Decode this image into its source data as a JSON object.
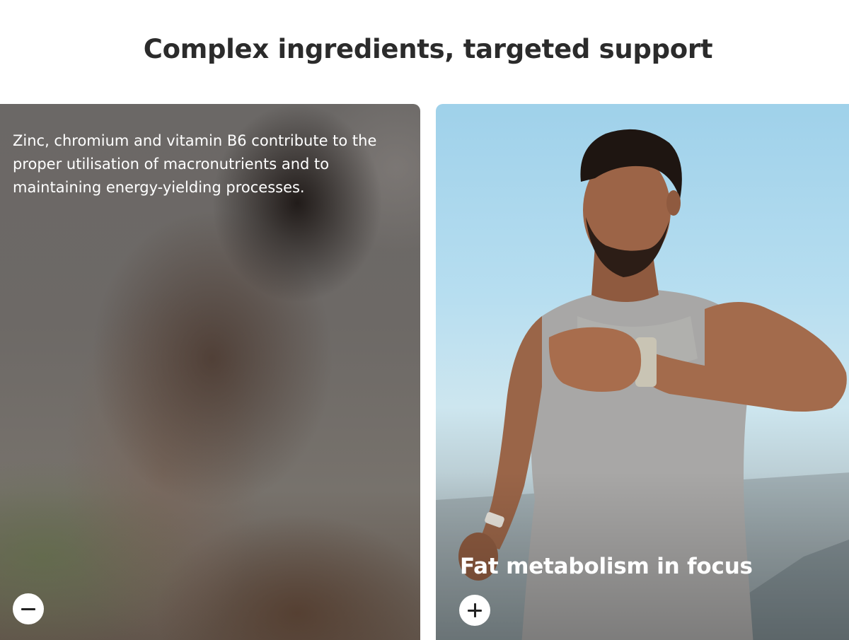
{
  "section": {
    "title": "Complex ingredients, targeted support"
  },
  "cards": [
    {
      "state": "expanded",
      "body": "Zinc, chromium and vitamin B6 contribute to the proper utilisation of macronutrients and to maintaining energy-yielding processes.",
      "toggle_icon": "minus-icon"
    },
    {
      "state": "collapsed",
      "title": "Fat metabolism in focus",
      "toggle_icon": "plus-icon",
      "image": "man-running-checking-smartwatch"
    }
  ]
}
